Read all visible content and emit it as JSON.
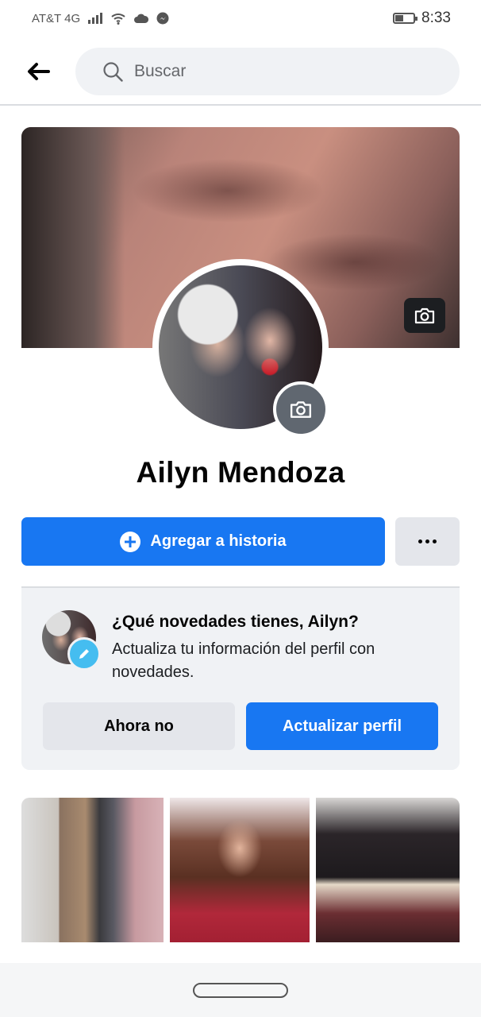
{
  "status_bar": {
    "carrier": "AT&T 4G",
    "time": "8:33"
  },
  "search": {
    "placeholder": "Buscar"
  },
  "profile": {
    "name": "Ailyn Mendoza",
    "add_story_label": "Agregar a historia"
  },
  "update_card": {
    "title": "¿Qué novedades tienes, Ailyn?",
    "body": "Actualiza tu información del perfil con novedades.",
    "dismiss_label": "Ahora no",
    "update_label": "Actualizar perfil"
  },
  "colors": {
    "accent": "#1877f2",
    "secondary_button": "#e4e6eb",
    "card_background": "#f0f2f5",
    "edit_badge": "#45bdf0"
  }
}
